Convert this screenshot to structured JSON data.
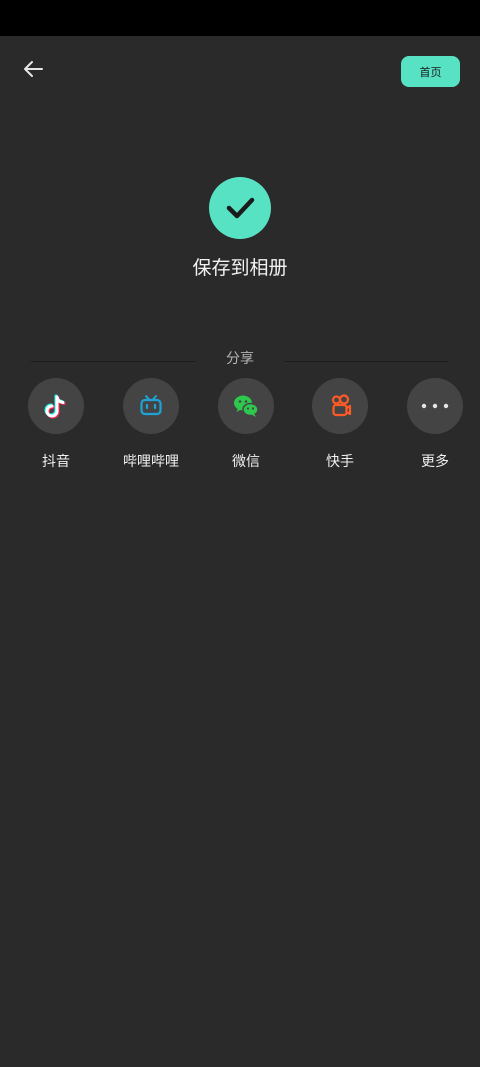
{
  "header": {
    "back_icon": "arrow-left-icon",
    "home_label": "首页"
  },
  "status": {
    "icon": "check-icon",
    "title": "保存到相册"
  },
  "share": {
    "label": "分享",
    "items": [
      {
        "label": "抖音",
        "icon": "douyin-icon"
      },
      {
        "label": "哔哩哔哩",
        "icon": "bilibili-icon"
      },
      {
        "label": "微信",
        "icon": "wechat-icon"
      },
      {
        "label": "快手",
        "icon": "kuaishou-icon"
      },
      {
        "label": "更多",
        "icon": "more-icon"
      }
    ]
  },
  "colors": {
    "background": "#2a2a2a",
    "accent": "#58e2c4",
    "icon_circle": "#444444",
    "bilibili": "#1fa3d6",
    "wechat": "#2dc84d",
    "kuaishou": "#ff5a26"
  }
}
